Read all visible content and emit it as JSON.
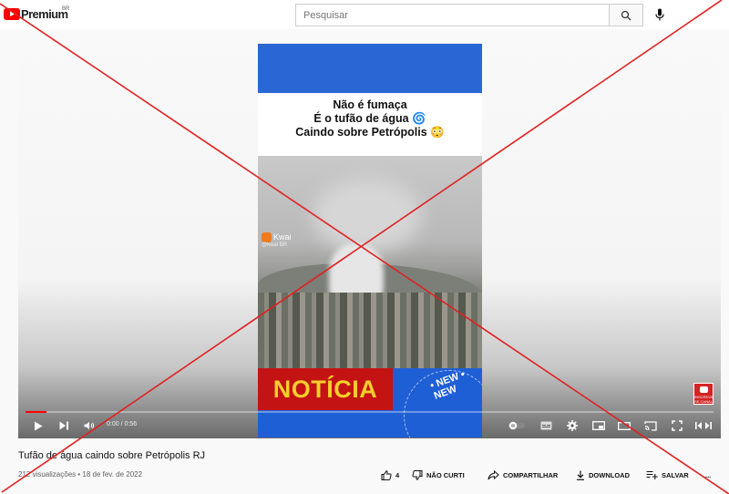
{
  "header": {
    "logo_text": "Premium",
    "region": "BR",
    "search_placeholder": "Pesquisar"
  },
  "video": {
    "caption_lines": [
      "Não é fumaça",
      "É o tufão de água 🌀",
      "Caindo sobre Petrópolis 😳"
    ],
    "kwai_label": "Kwai",
    "kwai_handle": "@kwai BR",
    "banner_text": "NOTÍCIA",
    "new_text": "• NEW • NEW",
    "subscribe_label": "INSCREVA-SE CANAL"
  },
  "player": {
    "time": "0:00 / 0:56",
    "progress_fraction": 0.03
  },
  "info": {
    "title": "Tufão de água caindo sobre Petrópolis RJ",
    "meta": "212 visualizações • 18 de fev. de 2022"
  },
  "actions": {
    "likes": "4",
    "dislike": "NÃO CURTI",
    "share": "COMPARTILHAR",
    "download": "DOWNLOAD",
    "save": "SALVAR",
    "more": "..."
  },
  "colors": {
    "brand_red": "#ff0000",
    "overlay_x": "#e02020",
    "band_blue": "#2a67d4",
    "banner_red": "#c41313",
    "banner_yellow": "#f5cf2b"
  }
}
